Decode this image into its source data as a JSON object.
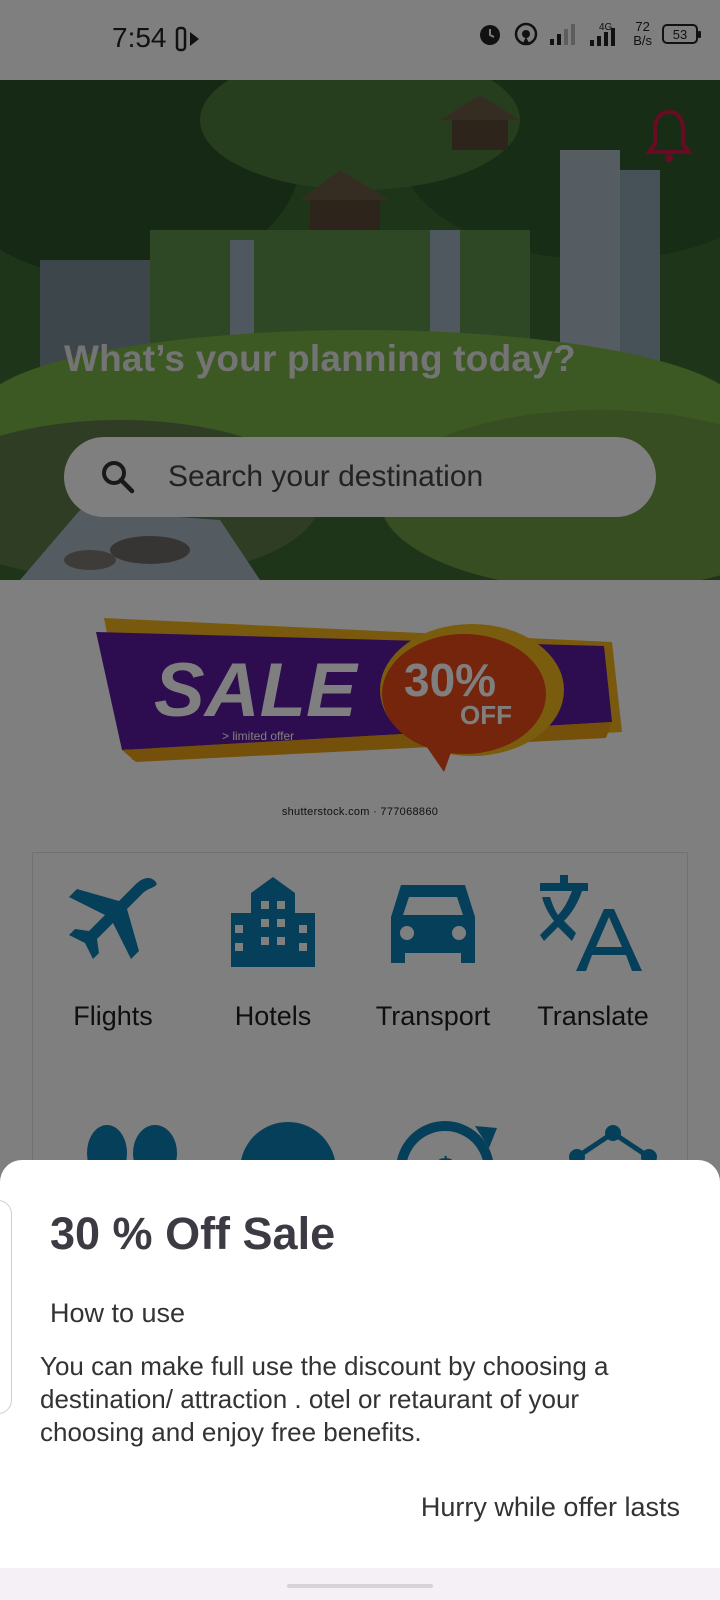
{
  "status_bar": {
    "time": "7:54",
    "network": "4G",
    "speed_value": "72",
    "speed_unit": "B/s",
    "battery": "53"
  },
  "hero": {
    "title": "What’s your planning today?",
    "search_placeholder": "Search your destination",
    "bell_color": "#d01848"
  },
  "banner": {
    "sale_text": "SALE",
    "limited_text": "> limited offer",
    "percent_text": "30%",
    "off_text": "OFF",
    "credit": "shutterstock.com · 777068860"
  },
  "services": {
    "icon_color": "#0a7fb4",
    "items": [
      {
        "label": "Flights",
        "icon": "airplane-icon"
      },
      {
        "label": "Hotels",
        "icon": "building-icon"
      },
      {
        "label": "Transport",
        "icon": "car-icon"
      },
      {
        "label": "Translate",
        "icon": "translate-icon"
      }
    ]
  },
  "sheet": {
    "title": "30 % Off Sale",
    "subtitle": "How to use",
    "body": "You can make full use the discount by choosing a destination/ attraction . otel or retaurant of your choosing and enjoy free benefits.",
    "cta": "Hurry while offer lasts"
  }
}
